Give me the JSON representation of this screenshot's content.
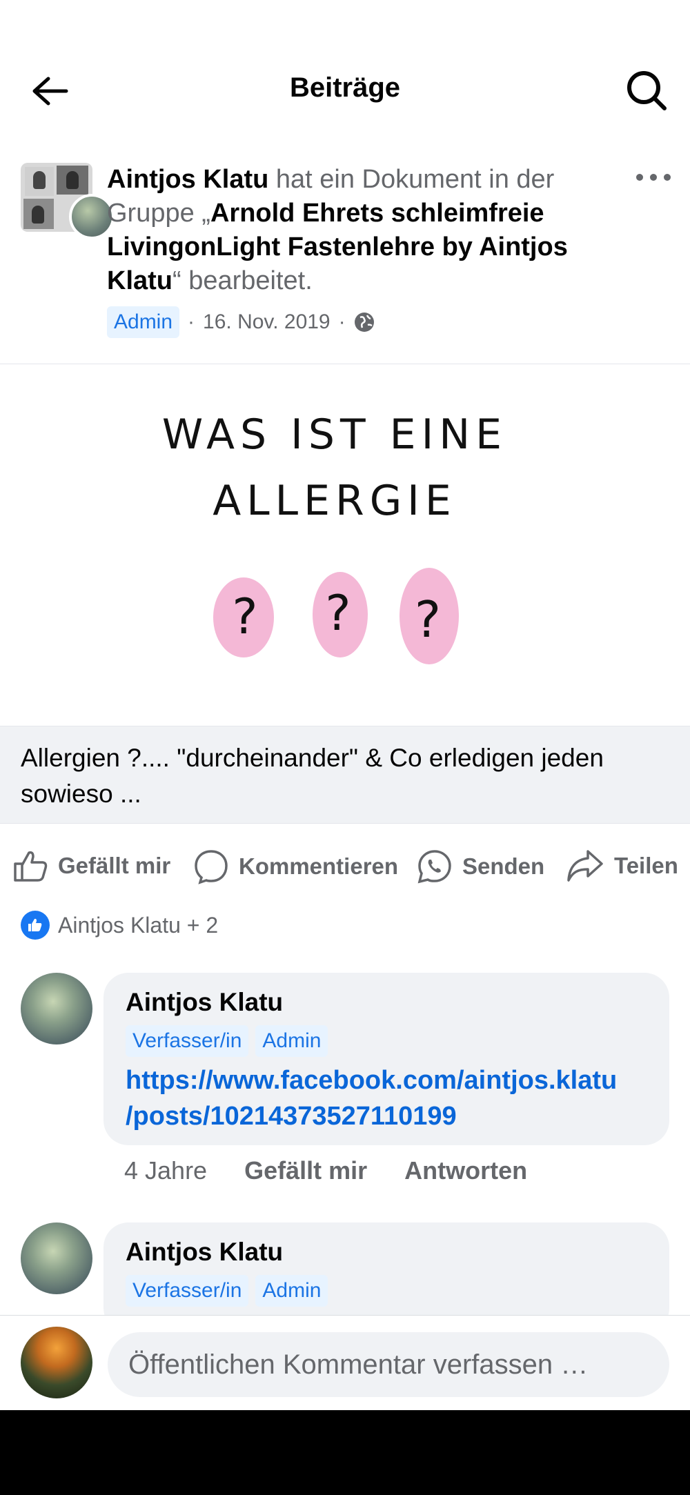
{
  "header": {
    "title": "Beiträge",
    "back_icon": "arrow-left-icon",
    "search_icon": "search-icon"
  },
  "post": {
    "author": "Aintjos Klatu",
    "action_text": " hat ein Dokument in der Gruppe „",
    "group_name": "Arnold Ehrets  schleimfreie LivingonLight   Fastenlehre  by Aintjos Klatu",
    "action_suffix": "“ bearbeitet.",
    "role_badge": "Admin",
    "date": "16. Nov. 2019",
    "separator": "·",
    "visibility_icon": "globe-icon",
    "more_icon": "more-dots-icon"
  },
  "document": {
    "image_text_line1": "WAS IST EINE",
    "image_text_line2": "ALLERGIE",
    "question_mark": "?",
    "caption": "Allergien ?.... \"durcheinander\" & Co erledigen jeden sowieso ..."
  },
  "actions": {
    "like": "Gefällt mir",
    "comment": "Kommentieren",
    "send": "Senden",
    "share": "Teilen"
  },
  "reactions": {
    "summary": "Aintjos Klatu + 2"
  },
  "comments": [
    {
      "name": "Aintjos Klatu",
      "badges": [
        "Verfasser/in",
        "Admin"
      ],
      "link_line1": "https://www.facebook.com/aintjos.klatu",
      "link_line2": "/posts/10214373527110199",
      "time": "4 Jahre",
      "like": "Gefällt mir",
      "reply": "Antworten"
    },
    {
      "name": "Aintjos Klatu",
      "badges": [
        "Verfasser/in",
        "Admin"
      ]
    }
  ],
  "composer": {
    "placeholder": "Öffentlichen Kommentar verfassen …"
  },
  "colors": {
    "accent": "#1877f2",
    "link": "#0a66d8",
    "secondary_text": "#65676b",
    "bubble_bg": "#f0f2f5",
    "badge_bg": "#e7f3ff",
    "pink": "#f4b8d6"
  }
}
